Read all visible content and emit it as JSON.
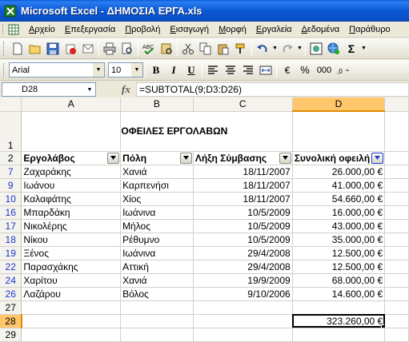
{
  "window": {
    "title": "Microsoft Excel - ΔΗΜΟΣΙΑ ΕΡΓΑ.xls"
  },
  "menu": {
    "items": [
      "Αρχείο",
      "Επεξεργασία",
      "Προβολή",
      "Εισαγωγή",
      "Μορφή",
      "Εργαλεία",
      "Δεδομένα",
      "Παράθυρο"
    ]
  },
  "toolbar": {
    "sigma": "Σ"
  },
  "format": {
    "font_name": "Arial",
    "font_size": "10",
    "bold": "B",
    "italic": "I",
    "underline": "U",
    "euro": "€",
    "percent": "%",
    "thousands": "000"
  },
  "formula_bar": {
    "name_box": "D28",
    "fx": "fx",
    "formula": "=SUBTOTAL(9;D3:D26)"
  },
  "columns": [
    "A",
    "B",
    "C",
    "D"
  ],
  "sheet": {
    "title": "ΟΦΕΙΛΕΣ ΕΡΓΟΛΑΒΩΝ",
    "headers": [
      "Εργολάβος",
      "Πόλη",
      "Λήξη Σύμβασης",
      "Συνολική οφειλή"
    ],
    "rows": [
      {
        "row": "7",
        "a": "Ζαχαράκης",
        "b": "Χανιά",
        "c": "18/11/2007",
        "d": "26.000,00 €"
      },
      {
        "row": "9",
        "a": "Ιωάνου",
        "b": "Καρπενήσι",
        "c": "18/11/2007",
        "d": "41.000,00 €"
      },
      {
        "row": "10",
        "a": "Καλαφάτης",
        "b": "Χίος",
        "c": "18/11/2007",
        "d": "54.660,00 €"
      },
      {
        "row": "16",
        "a": "Μπαρδάκη",
        "b": "Ιωάνινα",
        "c": "10/5/2009",
        "d": "16.000,00 €"
      },
      {
        "row": "17",
        "a": "Νικολέρης",
        "b": "Μήλος",
        "c": "10/5/2009",
        "d": "43.000,00 €"
      },
      {
        "row": "18",
        "a": "Νίκου",
        "b": "Ρέθυμνο",
        "c": "10/5/2009",
        "d": "35.000,00 €"
      },
      {
        "row": "19",
        "a": "Ξένος",
        "b": "Ιωάνινα",
        "c": "29/4/2008",
        "d": "12.500,00 €"
      },
      {
        "row": "22",
        "a": "Παρασχάκης",
        "b": "Αττική",
        "c": "29/4/2008",
        "d": "12.500,00 €"
      },
      {
        "row": "24",
        "a": "Χαρίτου",
        "b": "Χανιά",
        "c": "19/9/2009",
        "d": "68.000,00 €"
      },
      {
        "row": "26",
        "a": "Λαζάρου",
        "b": "Βόλος",
        "c": "9/10/2006",
        "d": "14.600,00 €"
      }
    ],
    "row_numbers": {
      "r1": "1",
      "r2": "2",
      "r27": "27",
      "r28": "28",
      "r29": "29"
    },
    "total": "323.260,00 €"
  },
  "colors": {
    "title_bar": "#0a5fd8",
    "selection_header": "#ffc66b",
    "filtered_row_number": "#1d38c8"
  }
}
